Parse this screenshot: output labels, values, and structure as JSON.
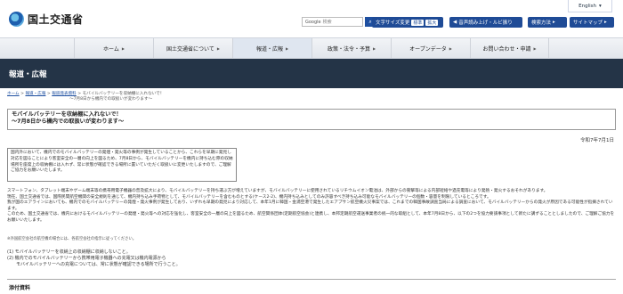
{
  "lang": {
    "label": "English"
  },
  "header": {
    "logo_text": "国土交通省",
    "search_provider": "Google",
    "search_suffix": "検索",
    "font_size_label": "文字サイズ変更",
    "font_options": [
      "標準",
      "拡大"
    ],
    "voice_label": "音声読み上げ・ルビ振り",
    "how_label": "検索方法",
    "sitemap_label": "サイトマップ"
  },
  "nav": [
    {
      "label": "ホーム"
    },
    {
      "label": "国土交通省について"
    },
    {
      "label": "報道・広報"
    },
    {
      "label": "政策・法令・予算"
    },
    {
      "label": "オープンデータ"
    },
    {
      "label": "お問い合わせ・申請"
    }
  ],
  "band": {
    "title": "報道・広報"
  },
  "breadcrumb": {
    "items": [
      "ホーム",
      "報道・広報",
      "報道発表資料"
    ],
    "current_line1": "モバイルバッテリーを収納棚に入れないで！",
    "current_line2": "～7月8日から機内での取扱いが変わります～"
  },
  "main": {
    "title_line1": "モバイルバッテリーを収納棚に入れないで！",
    "title_line2": "～7月8日から機内での取扱いが変わります～",
    "date": "令和7年7月1日",
    "summary": "国内外において、機内でのモバイルバッテリーの発煙・発火等の事例が発生していることから、これらを早期に発見し対応を図ることにより客室安全の一層の向上を図るため、7月8日から、モバイルバッテリーを機内に持ち込む際の収納場所を座席上の収納棚には入れず、常に状態が確認できる場所に置いていただく取扱いに変更いたしますので、ご理解ご協力をお願いいたします。",
    "para1": "スマートフォン、タブレット端末やゲーム端末等の携帯用電子機器の普及拡大により、モバイルバッテリーを持ち運ぶ方が増えていますが、モバイルバッテリーに使用されているリチウムイオン電池は、外部からの衝撃等による内部短絡や過充電等により発熱・発火するおそれがあります。",
    "para2": "現在、国土交通省では、国際民間航空機関の安全規則を通じて、機内持ち込み手荷物として、モバイルバッテリーを含むものとする(ケース2-2)、機内持ち込みとしてのみ許容すべき持ち込み可能なモバイルバッテリーの個数・容量を制限しているところです。",
    "para3": "我が国のエアラインにおいても、機内でのモバイルバッテリーの発煙・発火事例が発生しており、いずれも早期の発見により対応して、本年1月に韓国・金浦空港で発生したエアプサン航空機火災事案では、これまでの韓国事故調査当局による調査において、モバイルバッテリーからの発火が原因である可能性が指摘されています。",
    "para4": "このため、国土交通省では、機内におけるモバイルバッテリーの発煙・発火等への対応を強化し、客室安全の一層の向上を図るため、航空関係団体(定期航空協会)と連携し、本邦定期航空運送事業者の統一的な取組として、本年7月8日から、以下の2つを協力要請事項として新たに講ずることとしましたので、ご理解ご協力をお願いいたします。",
    "note": "※外国航空会社の航空機の場合には、各航空会社の指示に従ってください。",
    "list": [
      "(1) モバイルバッテリーを収納上の収納棚に収納しないこと。",
      "(2) 機内でのモバイルバッテリーから携帯用電子機器への充電又は機内電源から",
      "モバイルバッテリーへの充電については、常に状態が確認できる場所で行うこと。"
    ],
    "attachments_title": "添付資料"
  }
}
